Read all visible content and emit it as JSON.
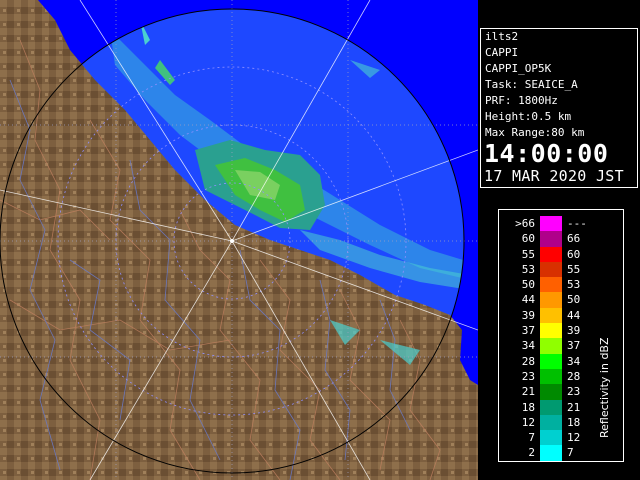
{
  "info": {
    "site": "ilts2",
    "product": "CAPPI",
    "product_name": "CAPPI_OP5K",
    "task": "Task: SEAICE_A",
    "prf": "PRF: 1800Hz",
    "height": "Height:0.5 km",
    "max_range": "Max Range:80 km",
    "time": "14:00:00",
    "date": "17 MAR 2020 JST"
  },
  "legend": {
    "unit_label": "Reflectivity in dBZ",
    "rows": [
      {
        "min": ">66",
        "max": "---",
        "color": "#ff00ff"
      },
      {
        "min": "60",
        "max": "66",
        "color": "#b0008a"
      },
      {
        "min": "55",
        "max": "60",
        "color": "#ff0000"
      },
      {
        "min": "53",
        "max": "55",
        "color": "#d83000"
      },
      {
        "min": "50",
        "max": "53",
        "color": "#ff6000"
      },
      {
        "min": "44",
        "max": "50",
        "color": "#ff9800"
      },
      {
        "min": "39",
        "max": "44",
        "color": "#ffc000"
      },
      {
        "min": "37",
        "max": "39",
        "color": "#ffff00"
      },
      {
        "min": "34",
        "max": "37",
        "color": "#90ff00"
      },
      {
        "min": "28",
        "max": "34",
        "color": "#00ff00"
      },
      {
        "min": "23",
        "max": "28",
        "color": "#00c000"
      },
      {
        "min": "21",
        "max": "23",
        "color": "#008a00"
      },
      {
        "min": "18",
        "max": "21",
        "color": "#009a70"
      },
      {
        "min": "12",
        "max": "18",
        "color": "#00b0a0"
      },
      {
        "min": "7",
        "max": "12",
        "color": "#00d0d0"
      },
      {
        "min": "2",
        "max": "7",
        "color": "#00ffff"
      }
    ]
  },
  "colors": {
    "sea_outside": "#0000ff",
    "sea_in_range": "#1e48ff",
    "land": "#8a6a48",
    "echo_weak": "#4ad0d0",
    "echo_mid": "#2aa070",
    "echo_strong": "#40c040"
  }
}
